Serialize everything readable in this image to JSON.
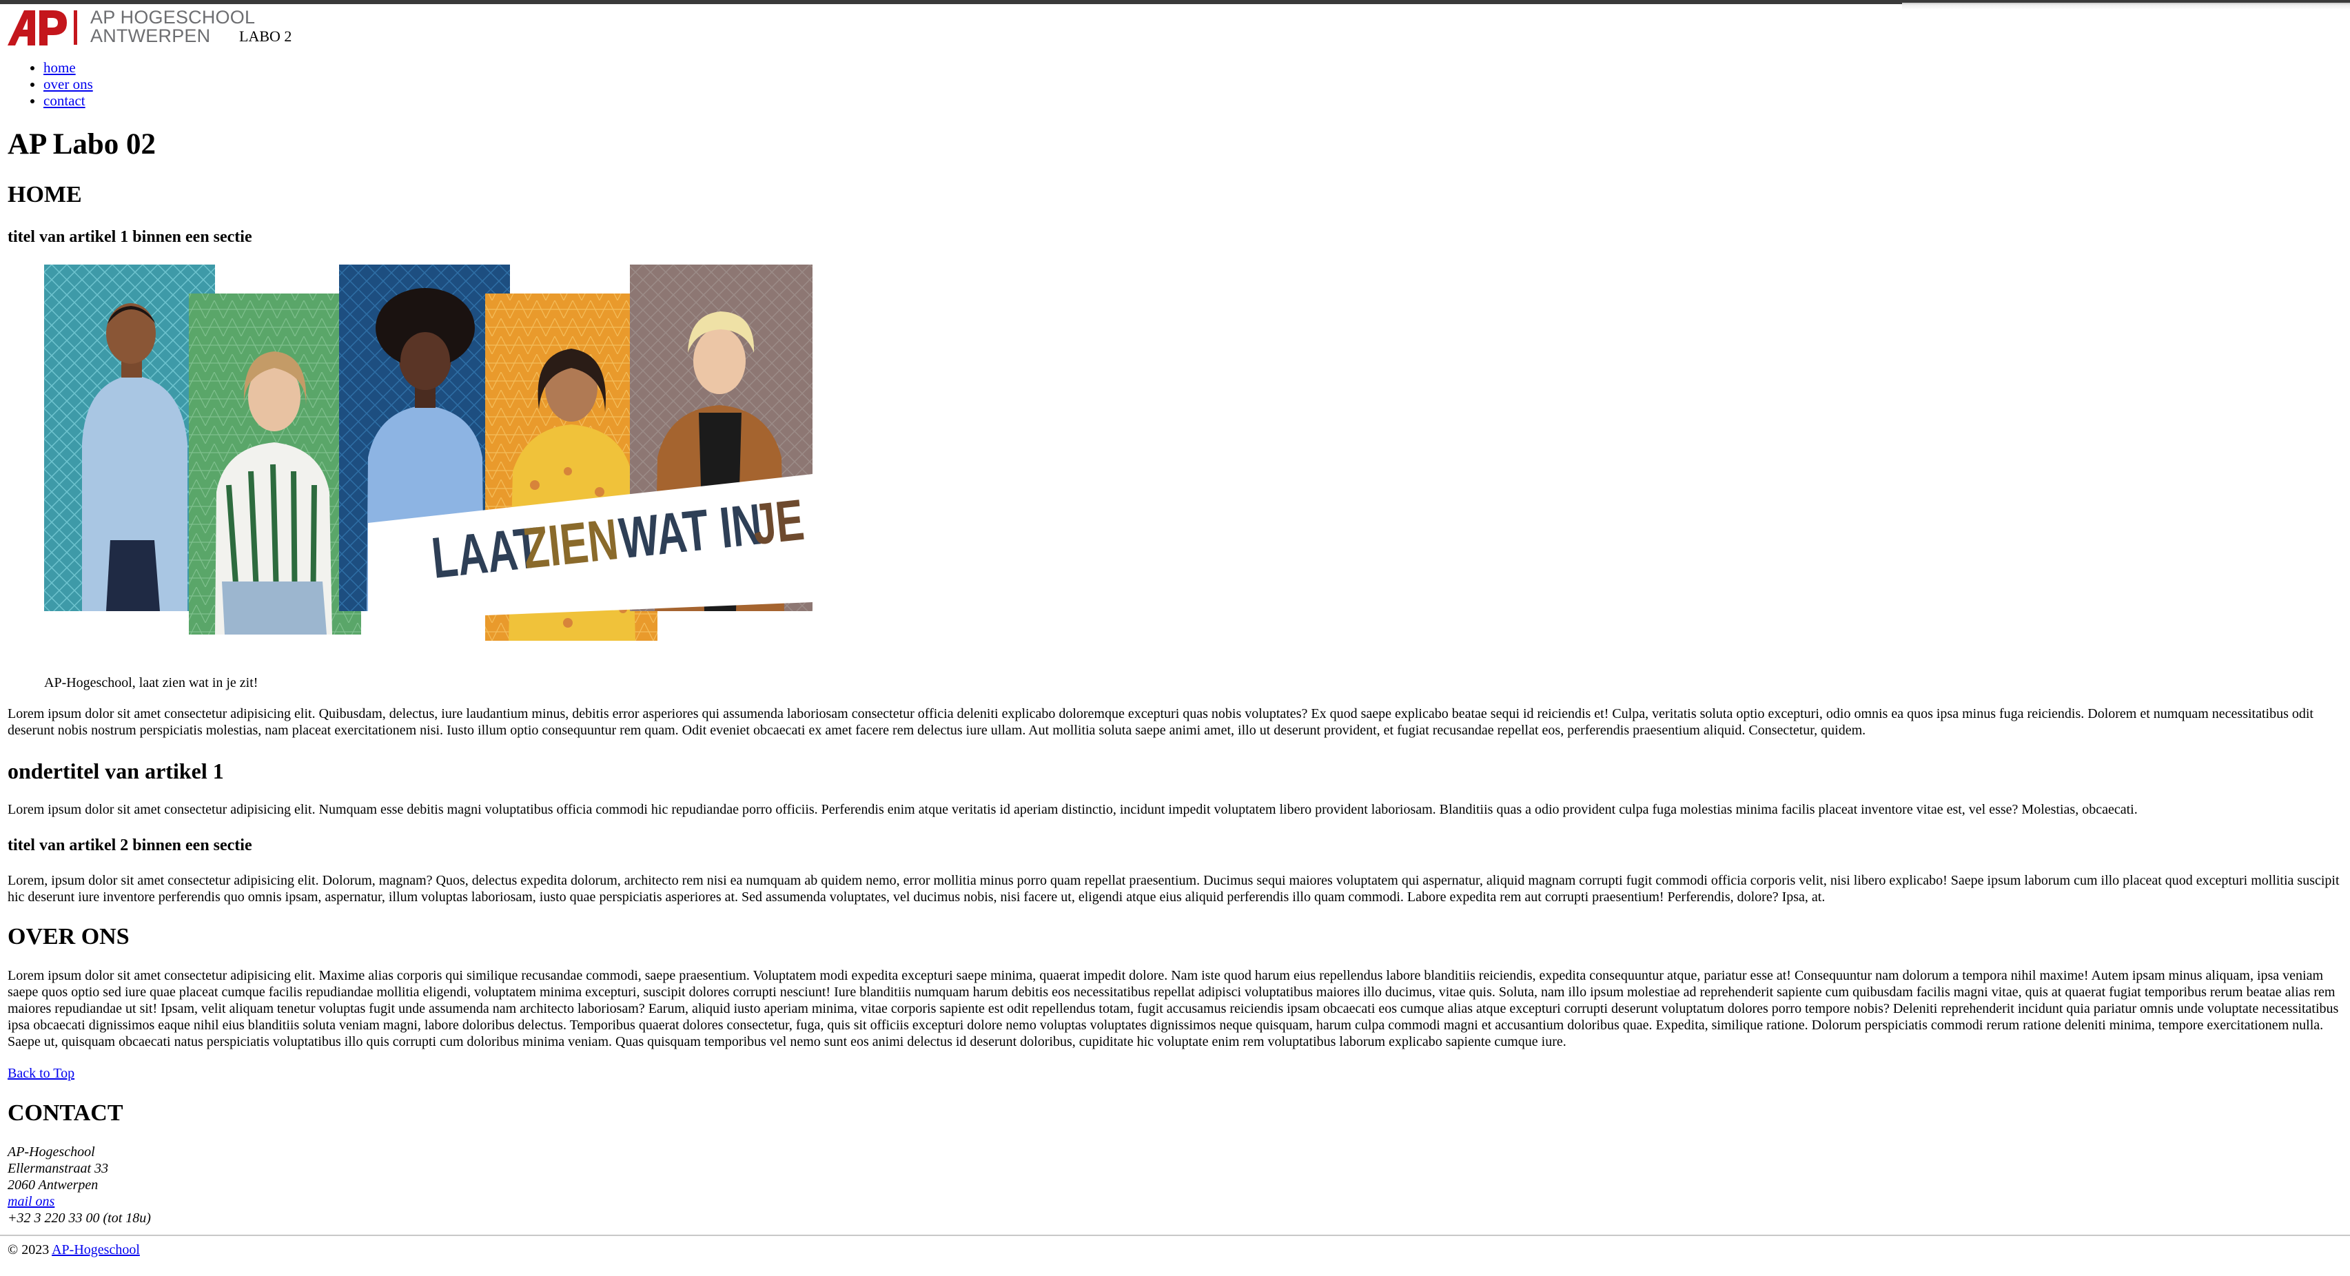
{
  "brand": {
    "line1": "AP HOGESCHOOL",
    "line2": "ANTWERPEN",
    "accent": "#c4161c",
    "gray": "#6d6e71"
  },
  "header": {
    "labo": "LABO 2"
  },
  "nav": [
    "home",
    "over ons",
    "contact"
  ],
  "page_title": "AP Labo 02",
  "home": {
    "heading": "HOME",
    "article1": {
      "title": "titel van artikel 1 binnen een sectie",
      "banner": {
        "word1": "LAAT",
        "word2": "ZIEN",
        "word3": "WAT IN",
        "word4": "JE ZIT"
      },
      "caption": "AP-Hogeschool, laat zien wat in je zit!",
      "text": "Lorem ipsum dolor sit amet consectetur adipisicing elit. Quibusdam, delectus, iure laudantium minus, debitis error asperiores qui assumenda laboriosam consectetur officia deleniti explicabo doloremque excepturi quas nobis voluptates? Ex quod saepe explicabo beatae sequi id reiciendis et! Culpa, veritatis soluta optio excepturi, odio omnis ea quos ipsa minus fuga reiciendis. Dolorem et numquam necessitatibus odit deserunt nobis nostrum perspiciatis molestias, nam placeat exercitationem nisi. Iusto illum optio consequuntur rem quam. Odit eveniet obcaecati ex amet facere rem delectus iure ullam. Aut mollitia soluta saepe animi amet, illo ut deserunt provident, et fugiat recusandae repellat eos, perferendis praesentium aliquid. Consectetur, quidem.",
      "subtitle": "ondertitel van artikel 1",
      "subtext": "Lorem ipsum dolor sit amet consectetur adipisicing elit. Numquam esse debitis magni voluptatibus officia commodi hic repudiandae porro officiis. Perferendis enim atque veritatis id aperiam distinctio, incidunt impedit voluptatem libero provident laboriosam. Blanditiis quas a odio provident culpa fuga molestias minima facilis placeat inventore vitae est, vel esse? Molestias, obcaecati."
    },
    "article2": {
      "title": "titel van artikel 2 binnen een sectie",
      "text": "Lorem, ipsum dolor sit amet consectetur adipisicing elit. Dolorum, magnam? Quos, delectus expedita dolorum, architecto rem nisi ea numquam ab quidem nemo, error mollitia minus porro quam repellat praesentium. Ducimus sequi maiores voluptatem qui aspernatur, aliquid magnam corrupti fugit commodi officia corporis velit, nisi libero explicabo! Saepe ipsum laborum cum illo placeat quod excepturi mollitia suscipit hic deserunt iure inventore perferendis quo omnis ipsam, aspernatur, illum voluptas laboriosam, iusto quae perspiciatis asperiores at. Sed assumenda voluptates, vel ducimus nobis, nisi facere ut, eligendi atque eius aliquid perferendis illo quam commodi. Labore expedita rem aut corrupti praesentium! Perferendis, dolore? Ipsa, at."
    }
  },
  "over_ons": {
    "heading": "OVER ONS",
    "text": "Lorem ipsum dolor sit amet consectetur adipisicing elit. Maxime alias corporis qui similique recusandae commodi, saepe praesentium. Voluptatem modi expedita excepturi saepe minima, quaerat impedit dolore. Nam iste quod harum eius repellendus labore blanditiis reiciendis, expedita consequuntur atque, pariatur esse at! Consequuntur nam dolorum a tempora nihil maxime! Autem ipsam minus aliquam, ipsa veniam saepe quos optio sed iure quae placeat cumque facilis repudiandae mollitia eligendi, voluptatem minima excepturi, suscipit dolores corrupti nesciunt! Iure blanditiis numquam harum debitis eos necessitatibus repellat adipisci voluptatibus maiores illo ducimus, vitae quis. Soluta, nam illo ipsum molestiae ad reprehenderit sapiente cum quibusdam facilis magni vitae, quis at quaerat fugiat temporibus rerum beatae alias rem maiores repudiandae ut sit! Ipsam, velit aliquam tenetur voluptas fugit unde assumenda nam architecto laboriosam? Earum, aliquid iusto aperiam minima, vitae corporis sapiente est odit repellendus totam, fugit accusamus reiciendis ipsam obcaecati eos cumque alias atque excepturi corrupti deserunt voluptatum dolores porro tempore nobis? Deleniti reprehenderit incidunt quia pariatur omnis unde voluptate necessitatibus ipsa obcaecati dignissimos eaque nihil eius blanditiis soluta veniam magni, labore doloribus delectus. Temporibus quaerat dolores consectetur, fuga, quis sit officiis excepturi dolore nemo voluptas voluptates dignissimos neque quisquam, harum culpa commodi magni et accusantium doloribus quae. Expedita, similique ratione. Dolorum perspiciatis commodi rerum ratione deleniti minima, tempore exercitationem nulla. Saepe ut, quisquam obcaecati natus perspiciatis voluptatibus illo quis corrupti cum doloribus minima veniam. Quas quisquam temporibus vel nemo sunt eos animi delectus id deserunt doloribus, cupiditate hic voluptate enim rem voluptatibus laborum explicabo sapiente cumque iure.",
    "back_to_top": "Back to Top"
  },
  "contact": {
    "heading": "CONTACT",
    "name": "AP-Hogeschool",
    "street": "Ellermanstraat 33",
    "city": "2060 Antwerpen",
    "mail": "mail ons",
    "phone": "+32 3 220 33 00 (tot 18u)"
  },
  "footer": {
    "copyright": "© 2023",
    "link": "AP-Hogeschool"
  }
}
